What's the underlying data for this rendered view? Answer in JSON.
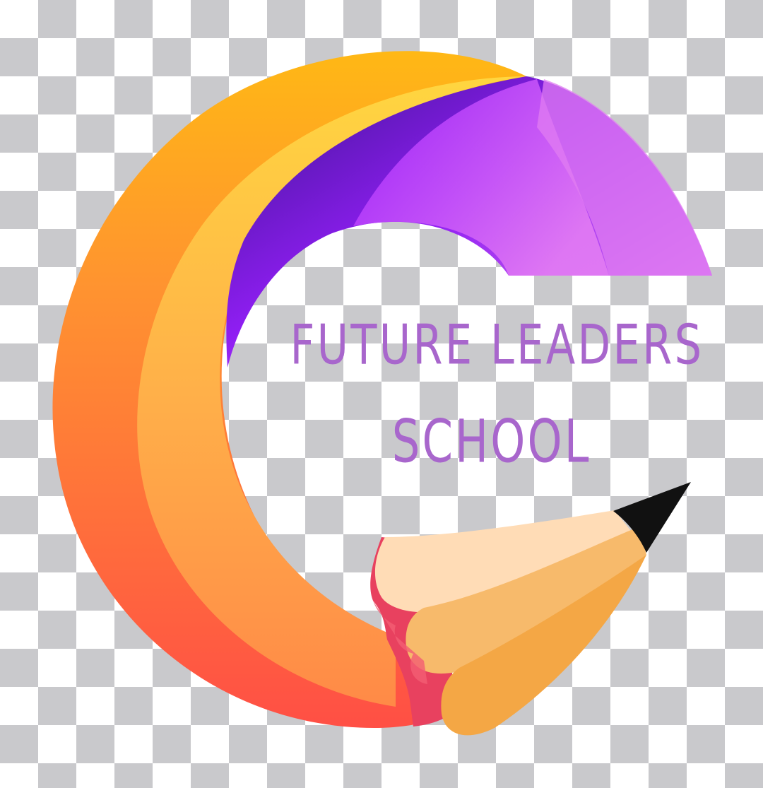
{
  "logo": {
    "text_line_1": "FUTURE LEADERS",
    "text_line_2": "SCHOOL",
    "mark": "pencil-swirl-logo",
    "colors": {
      "text": "#a866cc",
      "orange_outer": "#ff7a3c",
      "orange_top": "#ffb01a",
      "yellow_band": "#ffc53d",
      "purple_dark": "#4a169e",
      "purple_mid": "#9b1ff5",
      "purple_light": "#e277f2",
      "wood": "#f6ad4b",
      "wood_light": "#ffdcb6",
      "eraser_pink": "#e83d5f",
      "lead": "#111111",
      "background_check": "#c9c9cc"
    }
  }
}
